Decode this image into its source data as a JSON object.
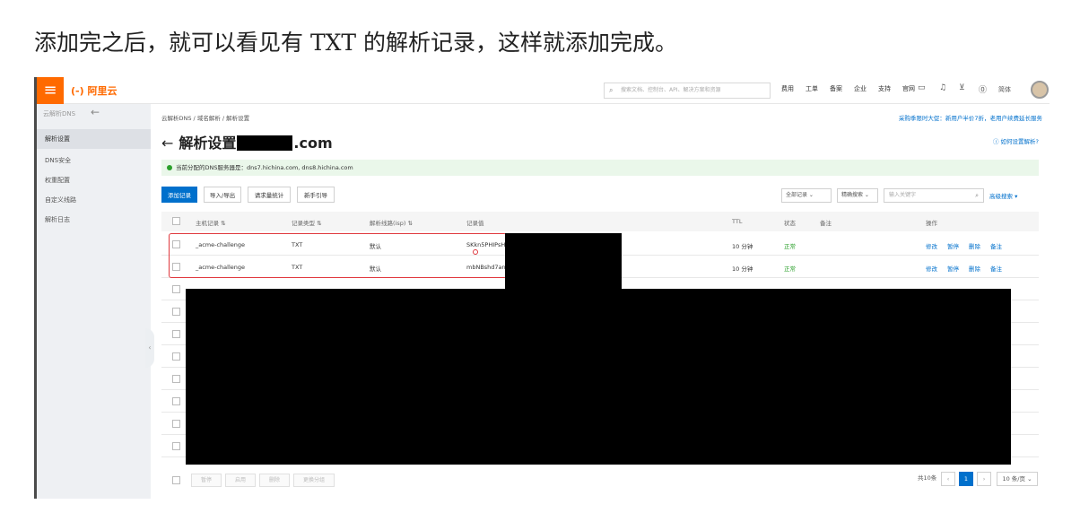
{
  "caption": "添加完之后，就可以看见有 TXT 的解析记录，这样就添加完成。",
  "topbar": {
    "logo": "(-) 阿里云",
    "search_placeholder": "搜索文档、控制台、API、解决方案和资源",
    "nav": [
      "费用",
      "工单",
      "备案",
      "企业",
      "支持",
      "官网"
    ]
  },
  "sidebar": {
    "title": "云解析DNS",
    "items": [
      "解析设置",
      "DNS安全",
      "权重配置",
      "自定义线路",
      "解析日志"
    ]
  },
  "breadcrumb": "云解析DNS / 域名解析 / 解析设置",
  "promo": "采购季限时大促：新用户半价7折，老用户续费延长服务",
  "page": {
    "title_prefix": "解析设置",
    "title_suffix": ".com",
    "help": "如何设置解析?"
  },
  "notice": "当前分配的DNS服务器是：dns7.hichina.com, dns8.hichina.com",
  "toolbar": {
    "add": "添加记录",
    "import_export": "导入/导出",
    "stats": "请求量统计",
    "guide": "新手引导",
    "filter_all": "全部记录",
    "exact_search": "精确搜索",
    "keyword_placeholder": "输入关键字",
    "advanced": "高级搜索"
  },
  "table": {
    "headers": [
      "主机记录",
      "记录类型",
      "解析线路(isp)",
      "记录值",
      "TTL",
      "状态",
      "备注",
      "操作"
    ],
    "rows": [
      {
        "host": "_acme-challenge",
        "type": "TXT",
        "line": "默认",
        "value": "SKkn5PHIPsH",
        "ttl": "10 分钟",
        "status": "正常"
      },
      {
        "host": "_acme-challenge",
        "type": "TXT",
        "line": "默认",
        "value": "mbNBshd7an",
        "ttl": "10 分钟",
        "status": "正常"
      }
    ],
    "ops": [
      "修改",
      "暂停",
      "删除",
      "备注"
    ]
  },
  "footer": {
    "batch": [
      "暂停",
      "启用",
      "删除",
      "更换分组"
    ],
    "total": "共10条",
    "current_page": "1",
    "page_size": "10 条/页"
  }
}
